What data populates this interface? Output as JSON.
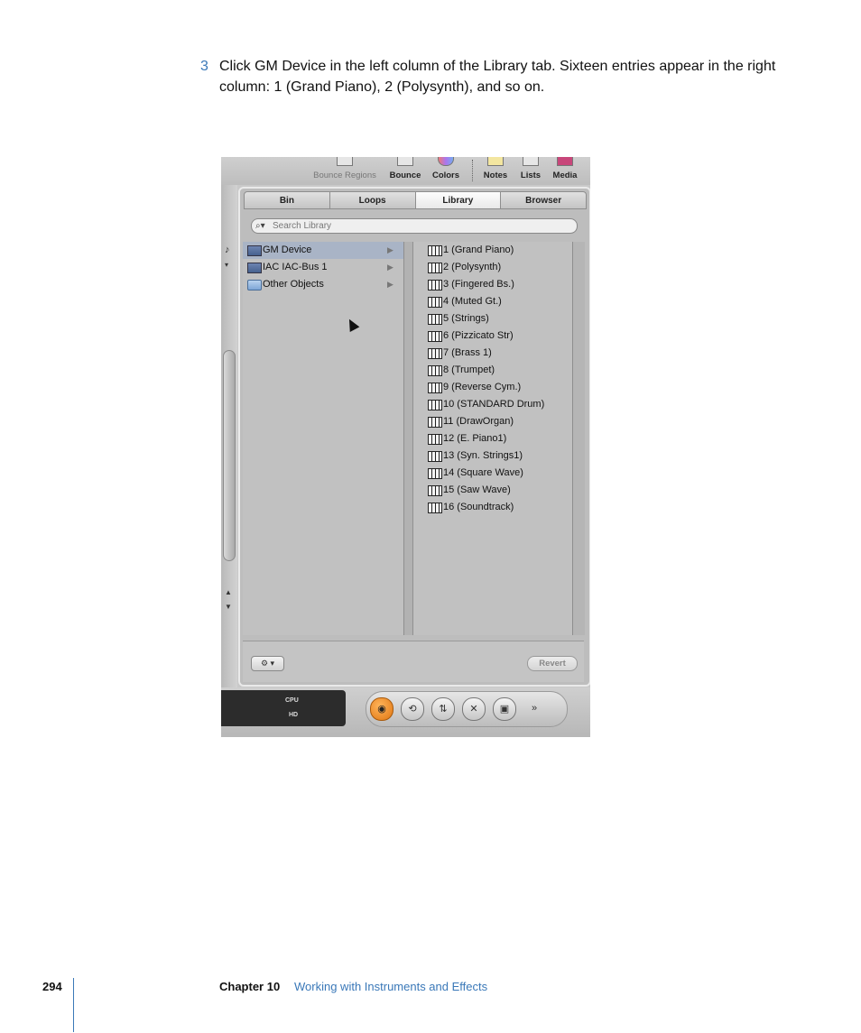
{
  "step": {
    "number": "3",
    "text": "Click GM Device in the left column of the Library tab. Sixteen entries appear in the right column:  1 (Grand Piano), 2 (Polysynth), and so on."
  },
  "toolbar": {
    "items": [
      "Bounce Regions",
      "Bounce",
      "Colors",
      "Notes",
      "Lists",
      "Media"
    ]
  },
  "tabs": [
    "Bin",
    "Loops",
    "Library",
    "Browser"
  ],
  "active_tab": "Library",
  "search": {
    "placeholder": "Search Library"
  },
  "left_column": [
    {
      "label": "GM Device",
      "icon": "device-icon",
      "selected": true
    },
    {
      "label": "IAC IAC-Bus 1",
      "icon": "device-icon",
      "selected": false
    },
    {
      "label": "Other Objects",
      "icon": "folder-icon",
      "selected": false
    }
  ],
  "right_column": [
    "1 (Grand Piano)",
    "2 (Polysynth)",
    "3 (Fingered Bs.)",
    "4 (Muted Gt.)",
    "5 (Strings)",
    "6 (Pizzicato Str)",
    "7 (Brass 1)",
    "8 (Trumpet)",
    "9 (Reverse Cym.)",
    "10 (STANDARD Drum)",
    "11 (DrawOrgan)",
    "12 (E. Piano1)",
    "13 (Syn. Strings1)",
    "14 (Square Wave)",
    "15 (Saw Wave)",
    "16 (Soundtrack)"
  ],
  "footer_panel": {
    "gear": "⚙ ▾",
    "revert": "Revert"
  },
  "status": {
    "cpu": "CPU",
    "hd": "HD"
  },
  "transport_glyphs": [
    "◉",
    "⟲",
    "⇅",
    "✕",
    "▣",
    "»"
  ],
  "page_footer": {
    "page_number": "294",
    "chapter": "Chapter 10",
    "chapter_title": "Working with Instruments and Effects"
  }
}
